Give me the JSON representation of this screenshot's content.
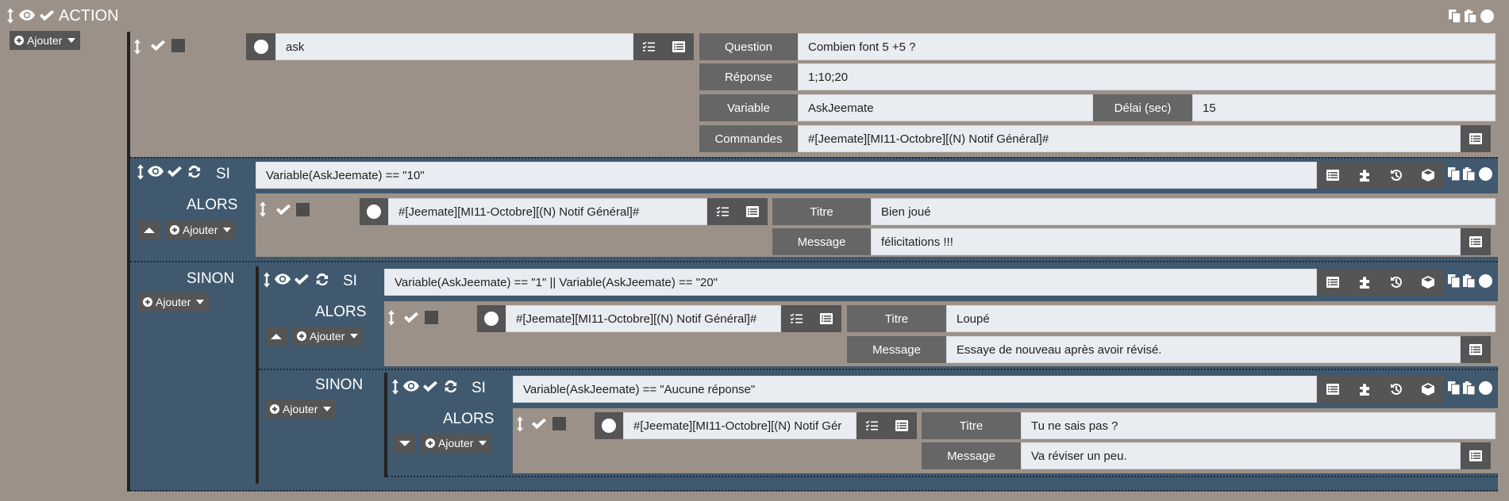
{
  "header": {
    "title": "ACTION"
  },
  "ajouter_label": "Ajouter",
  "main_action": {
    "name_value": "ask",
    "question_label": "Question",
    "question_value": "Combien font 5 +5  ?",
    "reponse_label": "Réponse",
    "reponse_value": "1;10;20",
    "variable_label": "Variable",
    "variable_value": "AskJeemate",
    "delai_label": "Délai (sec)",
    "delai_value": "15",
    "commandes_label": "Commandes",
    "commandes_value": "#[Jeemate][MI11-Octobre][(N) Notif Général]#"
  },
  "if1": {
    "si_label": "SI",
    "condition": "Variable(AskJeemate) == \"10\"",
    "alors_label": "ALORS",
    "cmd": "#[Jeemate][MI11-Octobre][(N) Notif Général]#",
    "titre_label": "Titre",
    "titre_value": "Bien joué",
    "message_label": "Message",
    "message_value": "félicitations !!!"
  },
  "else1": {
    "sinon_label": "SINON"
  },
  "if2": {
    "si_label": "SI",
    "condition": "Variable(AskJeemate) == \"1\" || Variable(AskJeemate) == \"20\"",
    "alors_label": "ALORS",
    "cmd": "#[Jeemate][MI11-Octobre][(N) Notif Général]#",
    "titre_label": "Titre",
    "titre_value": "Loupé",
    "message_label": "Message",
    "message_value": "Essaye de nouveau après avoir révisé."
  },
  "else2": {
    "sinon_label": "SINON"
  },
  "if3": {
    "si_label": "SI",
    "condition": "Variable(AskJeemate) == \"Aucune réponse\"",
    "alors_label": "ALORS",
    "cmd": "#[Jeemate][MI11-Octobre][(N) Notif Gér",
    "titre_label": "Titre",
    "titre_value": "Tu ne sais pas ?",
    "message_label": "Message",
    "message_value": "Va réviser un peu."
  }
}
